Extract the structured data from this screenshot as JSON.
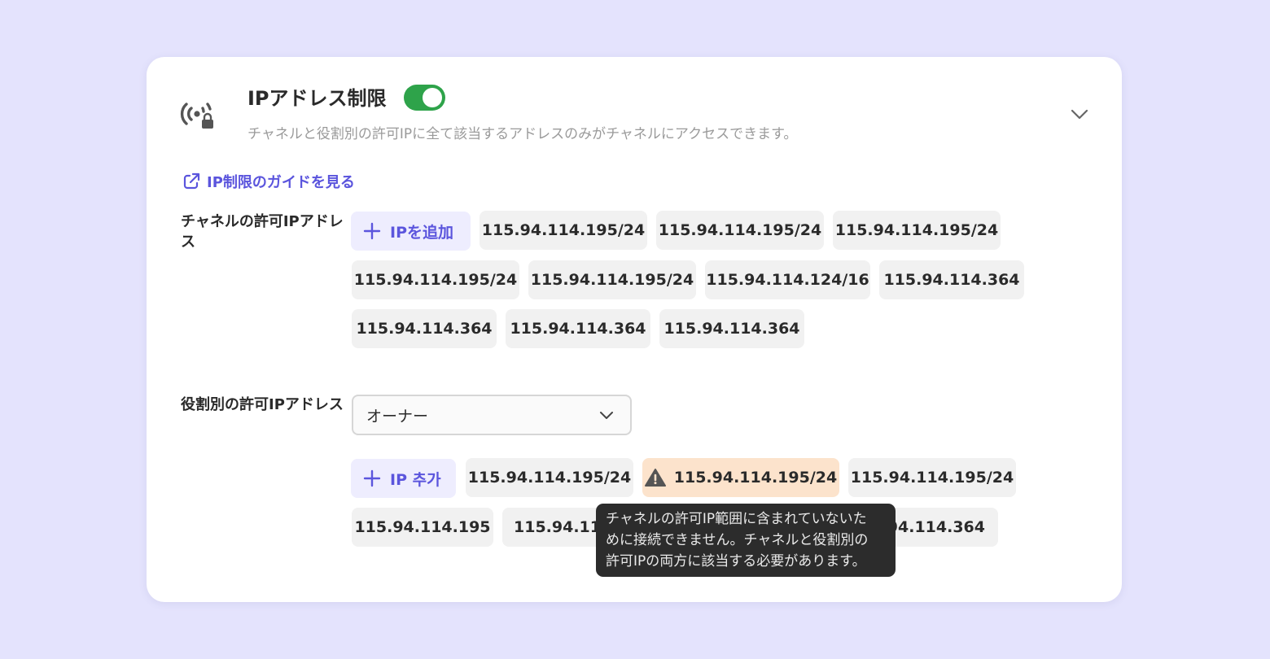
{
  "header": {
    "title": "IPアドレス制限",
    "toggle_on": true,
    "description": "チャネルと役割別の許可IPに全て該当するアドレスのみがチャネルにアクセスできます。",
    "icon": "signal-lock-icon",
    "collapse_icon": "chevron-down-icon"
  },
  "guide_link": {
    "label": "IP制限のガイドを見る",
    "icon": "external-link-icon"
  },
  "channel_section": {
    "label": "チャネルの許可IPアドレス",
    "add_button": "IPを追加",
    "ips": [
      "115.94.114.195/24",
      "115.94.114.195/24",
      "115.94.114.195/24",
      "115.94.114.195/24",
      "115.94.114.195/24",
      "115.94.114.124/16",
      "115.94.114.364",
      "115.94.114.364",
      "115.94.114.364",
      "115.94.114.364"
    ]
  },
  "role_section": {
    "label": "役割別の許可IPアドレス",
    "select_value": "オーナー",
    "add_button": "IP 추가",
    "ips": [
      "115.94.114.195/24",
      "115.94.114.195/24",
      "115.94.114.195/24",
      "115.94.114.195",
      "115.94.114.",
      "115.94.114.364"
    ],
    "warning_index": 1,
    "tooltip_lines": [
      "チャネルの許可IP範囲に含まれていないた",
      "めに接続できません。チャネルと役割別の",
      "許可IPの両方に該当する必要があります。"
    ]
  },
  "colors": {
    "background": "#e4e3fd",
    "accent": "#5b55dd",
    "toggle_on": "#2ea34a",
    "warning_chip": "#fce3cc",
    "tooltip_bg": "#2c2c2c"
  }
}
